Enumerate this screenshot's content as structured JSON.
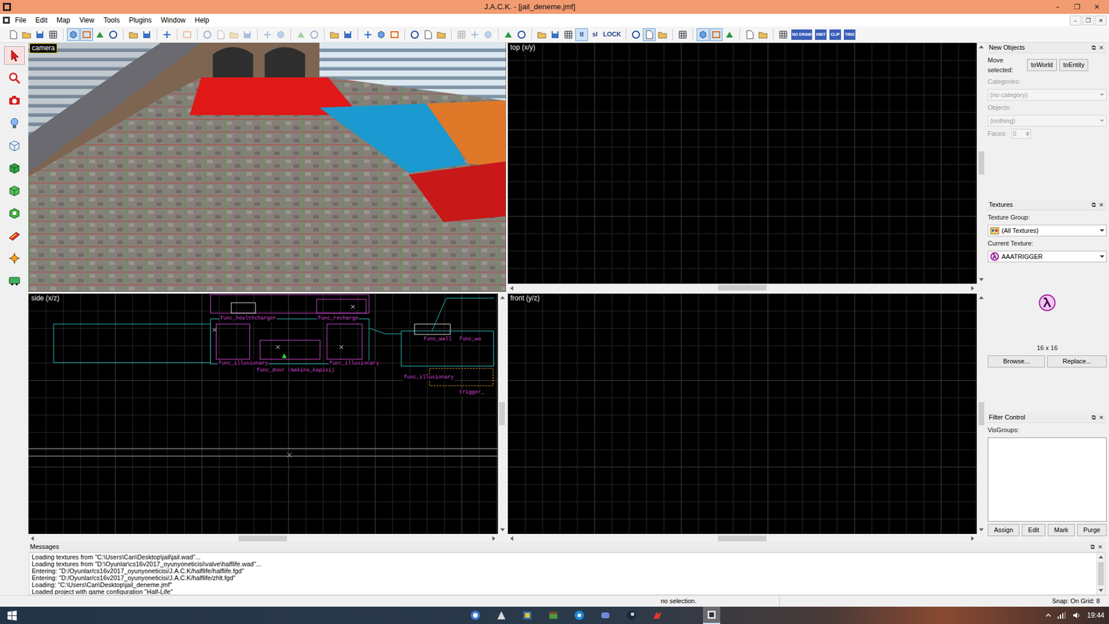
{
  "window": {
    "title": "J.A.C.K. - [jail_deneme.jmf]",
    "controls": [
      "–",
      "❐",
      "✕"
    ],
    "doc_controls": [
      "–",
      "❐",
      "✕"
    ]
  },
  "menu": [
    "File",
    "Edit",
    "Map",
    "View",
    "Tools",
    "Plugins",
    "Window",
    "Help"
  ],
  "toolbar": [
    {
      "kind": "icon",
      "pressed": false,
      "disabled": false
    },
    {
      "kind": "icon",
      "pressed": false,
      "disabled": false
    },
    {
      "kind": "icon",
      "pressed": false,
      "disabled": false
    },
    {
      "kind": "icon",
      "pressed": false,
      "disabled": false
    },
    {
      "kind": "sep"
    },
    {
      "kind": "icon",
      "pressed": true,
      "disabled": false
    },
    {
      "kind": "icon",
      "pressed": true,
      "disabled": false
    },
    {
      "kind": "icon",
      "pressed": false,
      "disabled": false
    },
    {
      "kind": "icon",
      "pressed": false,
      "disabled": false
    },
    {
      "kind": "sep"
    },
    {
      "kind": "icon",
      "pressed": false,
      "disabled": false
    },
    {
      "kind": "icon",
      "pressed": false,
      "disabled": false
    },
    {
      "kind": "sep"
    },
    {
      "kind": "icon",
      "pressed": false,
      "disabled": false
    },
    {
      "kind": "sep"
    },
    {
      "kind": "icon",
      "pressed": false,
      "disabled": true
    },
    {
      "kind": "sep"
    },
    {
      "kind": "icon",
      "pressed": false,
      "disabled": true
    },
    {
      "kind": "icon",
      "pressed": false,
      "disabled": true
    },
    {
      "kind": "icon",
      "pressed": false,
      "disabled": true
    },
    {
      "kind": "icon",
      "pressed": false,
      "disabled": true
    },
    {
      "kind": "sep"
    },
    {
      "kind": "icon",
      "pressed": false,
      "disabled": true
    },
    {
      "kind": "icon",
      "pressed": false,
      "disabled": true
    },
    {
      "kind": "sep"
    },
    {
      "kind": "icon",
      "pressed": false,
      "disabled": true
    },
    {
      "kind": "icon",
      "pressed": false,
      "disabled": true
    },
    {
      "kind": "sep"
    },
    {
      "kind": "icon",
      "pressed": false,
      "disabled": false
    },
    {
      "kind": "icon",
      "pressed": false,
      "disabled": false
    },
    {
      "kind": "sep"
    },
    {
      "kind": "icon",
      "pressed": false,
      "disabled": false
    },
    {
      "kind": "icon",
      "pressed": false,
      "disabled": false
    },
    {
      "kind": "icon",
      "pressed": false,
      "disabled": false
    },
    {
      "kind": "sep"
    },
    {
      "kind": "icon",
      "pressed": false,
      "disabled": false
    },
    {
      "kind": "icon",
      "pressed": false,
      "disabled": false
    },
    {
      "kind": "icon",
      "pressed": false,
      "disabled": false
    },
    {
      "kind": "sep"
    },
    {
      "kind": "icon",
      "pressed": false,
      "disabled": true
    },
    {
      "kind": "icon",
      "pressed": false,
      "disabled": true
    },
    {
      "kind": "icon",
      "pressed": false,
      "disabled": true
    },
    {
      "kind": "sep"
    },
    {
      "kind": "icon",
      "pressed": false,
      "disabled": false
    },
    {
      "kind": "icon",
      "pressed": false,
      "disabled": false
    },
    {
      "kind": "sep"
    },
    {
      "kind": "icon",
      "pressed": false,
      "disabled": false
    },
    {
      "kind": "icon",
      "pressed": false,
      "disabled": false
    },
    {
      "kind": "icon",
      "pressed": false,
      "disabled": false
    },
    {
      "kind": "text",
      "label": "tl",
      "pressed": true
    },
    {
      "kind": "text",
      "label": "sl",
      "pressed": false
    },
    {
      "kind": "text",
      "label": "LOCK",
      "pressed": false
    },
    {
      "kind": "sep"
    },
    {
      "kind": "icon",
      "pressed": false,
      "disabled": false
    },
    {
      "kind": "icon",
      "pressed": true,
      "disabled": false
    },
    {
      "kind": "icon",
      "pressed": false,
      "disabled": false
    },
    {
      "kind": "sep"
    },
    {
      "kind": "icon",
      "pressed": false,
      "disabled": false
    },
    {
      "kind": "sep"
    },
    {
      "kind": "icon",
      "pressed": true,
      "disabled": false
    },
    {
      "kind": "icon",
      "pressed": true,
      "disabled": false
    },
    {
      "kind": "icon",
      "pressed": false,
      "disabled": false
    },
    {
      "kind": "sep"
    },
    {
      "kind": "icon",
      "pressed": false,
      "disabled": false
    },
    {
      "kind": "icon",
      "pressed": false,
      "disabled": false
    },
    {
      "kind": "sep"
    },
    {
      "kind": "icon",
      "pressed": false,
      "disabled": false
    },
    {
      "kind": "tag",
      "label": "NO DRAW",
      "pressed": false
    },
    {
      "kind": "tag",
      "label": "HINT",
      "pressed": false
    },
    {
      "kind": "tag",
      "label": "CLIP",
      "pressed": false
    },
    {
      "kind": "tag",
      "label": "TRIG",
      "pressed": false
    }
  ],
  "tools": [
    {
      "selected": true
    },
    {
      "selected": false
    },
    {
      "selected": false
    },
    {
      "selected": false
    },
    {
      "selected": false
    },
    {
      "selected": false
    },
    {
      "selected": false
    },
    {
      "selected": false
    },
    {
      "selected": false
    },
    {
      "selected": false
    },
    {
      "selected": false
    }
  ],
  "viewports": [
    {
      "label": "camera",
      "kind": "camera"
    },
    {
      "label": "top (x/y)",
      "kind": "grid"
    },
    {
      "label": "side (x/z)",
      "kind": "side",
      "entities": [
        "func_healthcharger",
        "func_recharge",
        "func_illusionary",
        "func_door (makine_kapisi)",
        "func_illusionary",
        "func_wall",
        "func_wa",
        "func_illusionary",
        "trigger_"
      ]
    },
    {
      "label": "front (y/z)",
      "kind": "grid"
    }
  ],
  "panels": {
    "new_objects": {
      "title": "New Objects",
      "controls": [
        "⧉",
        "✕"
      ],
      "move_label": "Move selected:",
      "buttons": [
        "toWorld",
        "toEntity"
      ],
      "fields": [
        {
          "label": "Categories:",
          "value": "(no category)",
          "kind": "select",
          "disabled": true
        },
        {
          "label": "Objects:",
          "value": "(nothing)",
          "kind": "select",
          "disabled": true
        },
        {
          "label": "Faces:",
          "value": "0",
          "kind": "spin",
          "disabled": true
        }
      ]
    },
    "textures": {
      "title": "Textures",
      "controls": [
        "⧉",
        "✕"
      ],
      "group_label": "Texture Group:",
      "group_value": "(All Textures)",
      "current_label": "Current Texture:",
      "current_value": "AAATRIGGER",
      "size": "16 x 16",
      "buttons": [
        "Browse...",
        "Replace..."
      ]
    },
    "filter": {
      "title": "Filter Control",
      "controls": [
        "⧉",
        "✕"
      ],
      "visgroups_label": "VisGroups:",
      "visgroups": [],
      "buttons": [
        "Assign",
        "Edit",
        "Mark",
        "Purge"
      ]
    }
  },
  "messages": {
    "title": "Messages",
    "controls": [
      "⧉",
      "✕"
    ],
    "lines": [
      "Loading textures from \"C:\\Users\\Can\\Desktop\\jail\\jail.wad\"...",
      "Loading textures from \"D:\\Oyunlar\\cs16v2017_oyunyoneticisi\\valve\\halflife.wad\"...",
      "Entering: \"D:/Oyunlar/cs16v2017_oyunyoneticisi/J.A.C.K/halflife/halflife.fgd\"",
      "Entering: \"D:/Oyunlar/cs16v2017_oyunyoneticisi/J.A.C.K/halflife/zhlt.fgd\"",
      "Loading: \"C:\\Users\\Can\\Desktop\\jail_deneme.jmf\"",
      "Loaded project with game configuration \"Half-Life\""
    ]
  },
  "status_bar": [
    "no selection.",
    "Snap: On Grid: 8"
  ],
  "taskbar": {
    "apps": [
      {
        "selected": false
      },
      {
        "selected": false
      },
      {
        "selected": false
      },
      {
        "selected": false
      },
      {
        "selected": false
      },
      {
        "selected": false
      },
      {
        "selected": false
      },
      {
        "selected": false
      },
      {
        "selected": true
      }
    ],
    "time": "19:44"
  }
}
